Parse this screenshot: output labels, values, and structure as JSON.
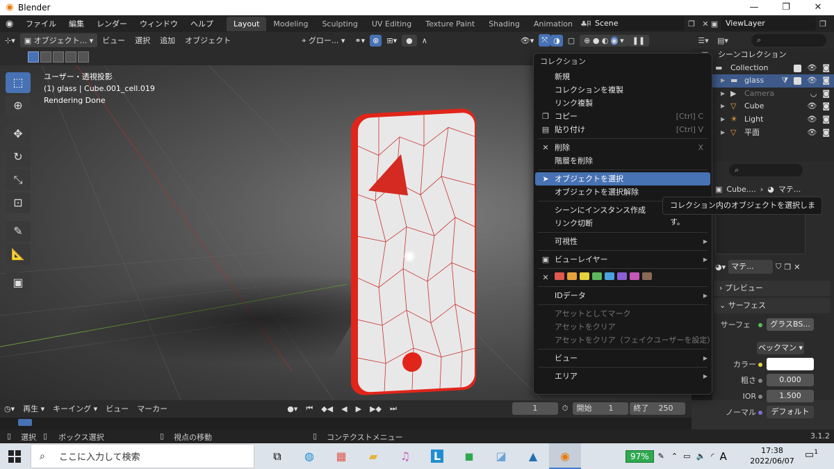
{
  "window": {
    "title": "Blender",
    "minimize": "—",
    "maximize": "❐",
    "close": "✕"
  },
  "menubar": [
    "ファイル",
    "編集",
    "レンダー",
    "ウィンドウ",
    "ヘルプ"
  ],
  "workspaces": [
    {
      "label": "Layout",
      "active": true
    },
    {
      "label": "Modeling"
    },
    {
      "label": "Sculpting"
    },
    {
      "label": "UV Editing"
    },
    {
      "label": "Texture Paint"
    },
    {
      "label": "Shading"
    },
    {
      "label": "Animation"
    },
    {
      "label": "Rendering"
    }
  ],
  "scene": "Scene",
  "view_layer": "ViewLayer",
  "viewport_header": {
    "mode": "オブジェクト...",
    "menus": [
      "ビュー",
      "選択",
      "追加",
      "オブジェクト"
    ],
    "orientation": "グロー..."
  },
  "viewport_info": {
    "projection": "ユーザー・透視投影",
    "object": "(1) glass | Cube.001_cell.019",
    "status": "Rendering Done"
  },
  "context_menu": {
    "title": "コレクション",
    "groups": [
      [
        {
          "label": "新規"
        },
        {
          "label": "コレクションを複製"
        },
        {
          "label": "リンク複製"
        },
        {
          "label": "コピー",
          "icon": "copy-icon",
          "shortcut": "[Ctrl] C"
        },
        {
          "label": "貼り付け",
          "icon": "paste-icon",
          "shortcut": "[Ctrl] V"
        }
      ],
      [
        {
          "label": "削除",
          "icon": "x-icon",
          "shortcut": "X"
        },
        {
          "label": "階層を削除"
        }
      ],
      [
        {
          "label": "オブジェクトを選択",
          "icon": "cursor-icon",
          "highlight": true
        },
        {
          "label": "オブジェクトを選択解除"
        }
      ],
      [
        {
          "label": "シーンにインスタンス作成"
        },
        {
          "label": "リンク切断"
        }
      ],
      [
        {
          "label": "可視性",
          "submenu": true
        }
      ],
      [
        {
          "label": "ビューレイヤー",
          "icon": "viewlayer-icon",
          "submenu": true
        }
      ],
      [
        {
          "label": "",
          "colortags": true
        }
      ],
      [
        {
          "label": "IDデータ",
          "submenu": true
        }
      ],
      [
        {
          "label": "アセットとしてマーク",
          "disabled": true
        },
        {
          "label": "アセットをクリア",
          "disabled": true
        },
        {
          "label": "アセットをクリア（フェイクユーザーを設定）",
          "disabled": true
        }
      ],
      [
        {
          "label": "ビュー",
          "submenu": true
        }
      ],
      [
        {
          "label": "エリア",
          "submenu": true
        }
      ]
    ],
    "color_tags": [
      "#e0584e",
      "#e8a23c",
      "#e6d23a",
      "#5cb85c",
      "#4aa3df",
      "#8c5fd6",
      "#c558b8",
      "#8a6a55"
    ]
  },
  "tooltip": "コレクション内のオブジェクトを選択します。",
  "outliner": {
    "root": "シーンコレクション",
    "items": [
      {
        "name": "Collection",
        "indent": 0
      },
      {
        "name": "glass",
        "indent": 1,
        "selected": true
      },
      {
        "name": "Camera",
        "indent": 1,
        "dim": true
      },
      {
        "name": "Cube",
        "indent": 1
      },
      {
        "name": "Light",
        "indent": 1
      },
      {
        "name": "平面",
        "indent": 1
      }
    ]
  },
  "properties": {
    "crumb_object": "Cube....",
    "crumb_material": "マテ...",
    "material_field": "マテ...",
    "panels": {
      "preview": "プレビュー",
      "surface": "サーフェス"
    },
    "surface_label": "サーフェ",
    "surface_value": "グラスBS...",
    "distribution": "ベックマン",
    "color_label": "カラー",
    "roughness_label": "粗さ",
    "roughness": "0.000",
    "ior_label": "IOR",
    "ior": "1.500",
    "normal_label": "ノーマル",
    "normal": "デフォルト"
  },
  "timeline": {
    "menus": [
      "再生",
      "キーイング",
      "ビュー",
      "マーカー"
    ],
    "current_frame": "1",
    "start_label": "開始",
    "start": "1",
    "end_label": "終了",
    "end": "250"
  },
  "statusbar": {
    "select": "選択",
    "box_select": "ボックス選択",
    "rotate_view": "視点の移動",
    "context_menu": "コンテクストメニュー",
    "version": "3.1.2"
  },
  "taskbar": {
    "search_placeholder": "ここに入力して検索",
    "battery": "97%",
    "time": "17:38",
    "date": "2022/06/07",
    "ime": "A",
    "notifications": "1"
  }
}
